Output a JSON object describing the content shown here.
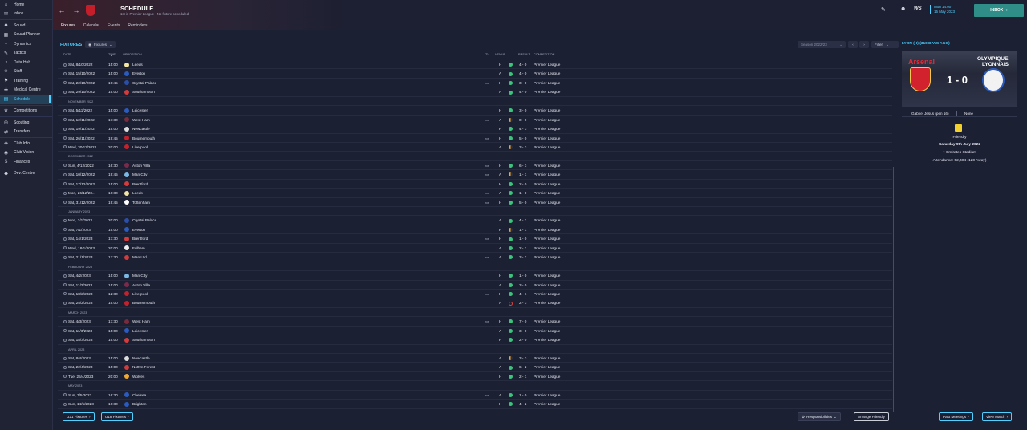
{
  "sidebar": {
    "items": [
      {
        "label": "Home",
        "icon": "home-icon",
        "glyph": "⌂"
      },
      {
        "label": "Inbox",
        "icon": "inbox-icon",
        "glyph": "✉"
      },
      {
        "label": "Squad",
        "icon": "squad-icon",
        "glyph": "☻"
      },
      {
        "label": "Squad Planner",
        "icon": "planner-icon",
        "glyph": "▦"
      },
      {
        "label": "Dynamics",
        "icon": "dynamics-icon",
        "glyph": "✦"
      },
      {
        "label": "Tactics",
        "icon": "tactics-icon",
        "glyph": "✎"
      },
      {
        "label": "Data Hub",
        "icon": "data-hub-icon",
        "glyph": "◔"
      },
      {
        "label": "Staff",
        "icon": "staff-icon",
        "glyph": "☺"
      },
      {
        "label": "Training",
        "icon": "training-icon",
        "glyph": "⚑"
      },
      {
        "label": "Medical Centre",
        "icon": "medical-icon",
        "glyph": "✚"
      },
      {
        "label": "Schedule",
        "icon": "schedule-icon",
        "glyph": "▤"
      },
      {
        "label": "Competitions",
        "icon": "trophy-icon",
        "glyph": "♛"
      },
      {
        "label": "Scouting",
        "icon": "scouting-icon",
        "glyph": "◎"
      },
      {
        "label": "Transfers",
        "icon": "transfers-icon",
        "glyph": "⇄"
      },
      {
        "label": "Club Info",
        "icon": "club-info-icon",
        "glyph": "◈"
      },
      {
        "label": "Club Vision",
        "icon": "club-vision-icon",
        "glyph": "◉"
      },
      {
        "label": "Finances",
        "icon": "finances-icon",
        "glyph": "$"
      },
      {
        "label": "Dev. Centre",
        "icon": "dev-centre-icon",
        "glyph": "◆"
      }
    ]
  },
  "header": {
    "title": "SCHEDULE",
    "subtitle": "1st in Premier League - No fixture scheduled",
    "tabs": [
      "Fixtures",
      "Calendar",
      "Events",
      "Reminders"
    ],
    "date_time": "Mon 14:00",
    "date": "15 May 2023",
    "inbox_label": "INBOX"
  },
  "fixtures": {
    "title": "FIXTURES",
    "view_label": "Fixtures",
    "season_label": "Season 2022/23",
    "filter_label": "Filter",
    "columns": {
      "date": "DATE",
      "time": "TIME",
      "opposition": "OPPOSITION",
      "tv": "TV",
      "venue": "VENUE",
      "result": "RESULT",
      "competition": "COMPETITION"
    },
    "accent": "#4fd0ff",
    "win_color": "#3cc47c",
    "draw_color": "#f0a830",
    "loss_color": "#e0443c"
  },
  "rows": [
    {
      "date": "Sat, 8/10/2022",
      "time": "15:00",
      "opp": "Leeds",
      "tv": "",
      "venue": "H",
      "res": "W",
      "score": "4 - 0",
      "comp": "Premier League",
      "c": "#f2e6a0"
    },
    {
      "date": "Sat, 15/10/2022",
      "time": "15:00",
      "opp": "Everton",
      "tv": "",
      "venue": "A",
      "res": "W",
      "score": "4 - 0",
      "comp": "Premier League",
      "c": "#2a5bbf"
    },
    {
      "date": "Sat, 22/10/2022",
      "time": "19:45",
      "opp": "Crystal Palace",
      "tv": "tv",
      "venue": "H",
      "res": "W",
      "score": "3 - 0",
      "comp": "Premier League",
      "c": "#2b4fa8"
    },
    {
      "date": "Sat, 29/10/2022",
      "time": "15:00",
      "opp": "Southampton",
      "tv": "",
      "venue": "A",
      "res": "W",
      "score": "4 - 0",
      "comp": "Premier League",
      "c": "#d63a3a"
    },
    {
      "month": "NOVEMBER 2022"
    },
    {
      "date": "Sat, 5/11/2022",
      "time": "15:00",
      "opp": "Leicester",
      "tv": "",
      "venue": "H",
      "res": "W",
      "score": "3 - 0",
      "comp": "Premier League",
      "c": "#2a5bbf"
    },
    {
      "date": "Sat, 12/11/2022",
      "time": "17:30",
      "opp": "West Ham",
      "tv": "tv",
      "venue": "A",
      "res": "D",
      "score": "0 - 0",
      "comp": "Premier League",
      "c": "#7a2a3a"
    },
    {
      "date": "Sat, 19/11/2022",
      "time": "15:00",
      "opp": "Newcastle",
      "tv": "",
      "venue": "H",
      "res": "W",
      "score": "4 - 3",
      "comp": "Premier League",
      "c": "#dddddd"
    },
    {
      "date": "Sat, 26/11/2022",
      "time": "19:45",
      "opp": "Bournemouth",
      "tv": "tv",
      "venue": "H",
      "res": "W",
      "score": "5 - 0",
      "comp": "Premier League",
      "c": "#c8202a"
    },
    {
      "date": "Wed, 30/11/2022",
      "time": "20:00",
      "opp": "Liverpool",
      "tv": "",
      "venue": "A",
      "res": "D",
      "score": "3 - 3",
      "comp": "Premier League",
      "c": "#c8202a"
    },
    {
      "month": "DECEMBER 2022"
    },
    {
      "date": "Sun, 4/12/2022",
      "time": "16:30",
      "opp": "Aston Villa",
      "tv": "tv",
      "venue": "H",
      "res": "W",
      "score": "6 - 3",
      "comp": "Premier League",
      "c": "#7a2a4a"
    },
    {
      "date": "Sat, 10/12/2022",
      "time": "19:45",
      "opp": "Man City",
      "tv": "tv",
      "venue": "A",
      "res": "D",
      "score": "1 - 1",
      "comp": "Premier League",
      "c": "#7ab8e6"
    },
    {
      "date": "Sat, 17/12/2022",
      "time": "15:00",
      "opp": "Brentford",
      "tv": "",
      "venue": "H",
      "res": "W",
      "score": "2 - 0",
      "comp": "Premier League",
      "c": "#d63a3a"
    },
    {
      "date": "Mon, 26/12/20...",
      "time": "16:30",
      "opp": "Leeds",
      "tv": "tv",
      "venue": "A",
      "res": "W",
      "score": "1 - 0",
      "comp": "Premier League",
      "c": "#f2e6a0"
    },
    {
      "date": "Sat, 31/12/2022",
      "time": "19:45",
      "opp": "Tottenham",
      "tv": "tv",
      "venue": "H",
      "res": "W",
      "score": "5 - 0",
      "comp": "Premier League",
      "c": "#ffffff"
    },
    {
      "month": "JANUARY 2023"
    },
    {
      "date": "Mon, 2/1/2023",
      "time": "20:00",
      "opp": "Crystal Palace",
      "tv": "",
      "venue": "A",
      "res": "W",
      "score": "4 - 1",
      "comp": "Premier League",
      "c": "#2b4fa8"
    },
    {
      "date": "Sat, 7/1/2023",
      "time": "15:00",
      "opp": "Everton",
      "tv": "",
      "venue": "H",
      "res": "D",
      "score": "1 - 1",
      "comp": "Premier League",
      "c": "#2a5bbf"
    },
    {
      "date": "Sat, 14/1/2023",
      "time": "17:30",
      "opp": "Brentford",
      "tv": "tv",
      "venue": "H",
      "res": "W",
      "score": "1 - 0",
      "comp": "Premier League",
      "c": "#d63a3a"
    },
    {
      "date": "Wed, 18/1/2023",
      "time": "20:00",
      "opp": "Fulham",
      "tv": "",
      "venue": "A",
      "res": "W",
      "score": "2 - 1",
      "comp": "Premier League",
      "c": "#eeeeee"
    },
    {
      "date": "Sat, 21/1/2023",
      "time": "17:30",
      "opp": "Man Utd",
      "tv": "tv",
      "venue": "A",
      "res": "W",
      "score": "3 - 2",
      "comp": "Premier League",
      "c": "#d63a3a"
    },
    {
      "month": "FEBRUARY 2023"
    },
    {
      "date": "Sat, 4/2/2023",
      "time": "15:00",
      "opp": "Man City",
      "tv": "",
      "venue": "H",
      "res": "W",
      "score": "1 - 0",
      "comp": "Premier League",
      "c": "#7ab8e6"
    },
    {
      "date": "Sat, 11/2/2023",
      "time": "15:00",
      "opp": "Aston Villa",
      "tv": "",
      "venue": "A",
      "res": "W",
      "score": "3 - 0",
      "comp": "Premier League",
      "c": "#7a2a4a"
    },
    {
      "date": "Sat, 18/2/2023",
      "time": "12:30",
      "opp": "Liverpool",
      "tv": "tv",
      "venue": "H",
      "res": "W",
      "score": "4 - 1",
      "comp": "Premier League",
      "c": "#c8202a"
    },
    {
      "date": "Sat, 25/2/2023",
      "time": "15:00",
      "opp": "Bournemouth",
      "tv": "",
      "venue": "A",
      "res": "L",
      "score": "2 - 3",
      "comp": "Premier League",
      "c": "#c8202a"
    },
    {
      "month": "MARCH 2023"
    },
    {
      "date": "Sat, 4/3/2023",
      "time": "17:30",
      "opp": "West Ham",
      "tv": "tv",
      "venue": "H",
      "res": "W",
      "score": "7 - 0",
      "comp": "Premier League",
      "c": "#7a2a3a"
    },
    {
      "date": "Sat, 11/3/2023",
      "time": "15:00",
      "opp": "Leicester",
      "tv": "",
      "venue": "A",
      "res": "W",
      "score": "3 - 0",
      "comp": "Premier League",
      "c": "#2a5bbf"
    },
    {
      "date": "Sat, 18/3/2023",
      "time": "15:00",
      "opp": "Southampton",
      "tv": "",
      "venue": "H",
      "res": "W",
      "score": "2 - 0",
      "comp": "Premier League",
      "c": "#d63a3a"
    },
    {
      "month": "APRIL 2023"
    },
    {
      "date": "Sat, 8/4/2023",
      "time": "15:00",
      "opp": "Newcastle",
      "tv": "",
      "venue": "A",
      "res": "D",
      "score": "3 - 3",
      "comp": "Premier League",
      "c": "#dddddd"
    },
    {
      "date": "Sat, 22/4/2023",
      "time": "15:00",
      "opp": "Nott'm Forest",
      "tv": "",
      "venue": "A",
      "res": "W",
      "score": "6 - 2",
      "comp": "Premier League",
      "c": "#d63a3a"
    },
    {
      "date": "Tue, 25/4/2023",
      "time": "20:00",
      "opp": "Wolves",
      "tv": "",
      "venue": "H",
      "res": "W",
      "score": "2 - 1",
      "comp": "Premier League",
      "c": "#f0a830"
    },
    {
      "month": "MAY 2023"
    },
    {
      "date": "Sun, 7/5/2023",
      "time": "16:30",
      "opp": "Chelsea",
      "tv": "tv",
      "venue": "A",
      "res": "W",
      "score": "1 - 0",
      "comp": "Premier League",
      "c": "#2a5bbf"
    },
    {
      "date": "Sun, 14/5/2023",
      "time": "16:30",
      "opp": "Brighton",
      "tv": "",
      "venue": "H",
      "res": "W",
      "score": "4 - 2",
      "comp": "Premier League",
      "c": "#2a5bbf"
    }
  ],
  "footer": {
    "u21": "U21 Fixtures",
    "u18": "U18 Fixtures",
    "responsibilities": "Responsibilities",
    "arrange": "Arrange Friendly",
    "past": "Past Meetings",
    "view": "View Match"
  },
  "side": {
    "header": "LYON (H) (310 DAYS AGO)",
    "home_team": "Arsenal",
    "away_team_line1": "OLYMPIQUE",
    "away_team_line2": "LYONNAIS",
    "score": "1 - 0",
    "home_scorer": "Gabriel Jesus (pen 16)",
    "away_scorer": "None",
    "comp": "Friendly",
    "match_date": "Saturday 9th July 2022",
    "stadium": "Emirates Stadium",
    "attendance": "Attendance: 52,404 (120 Away)"
  }
}
